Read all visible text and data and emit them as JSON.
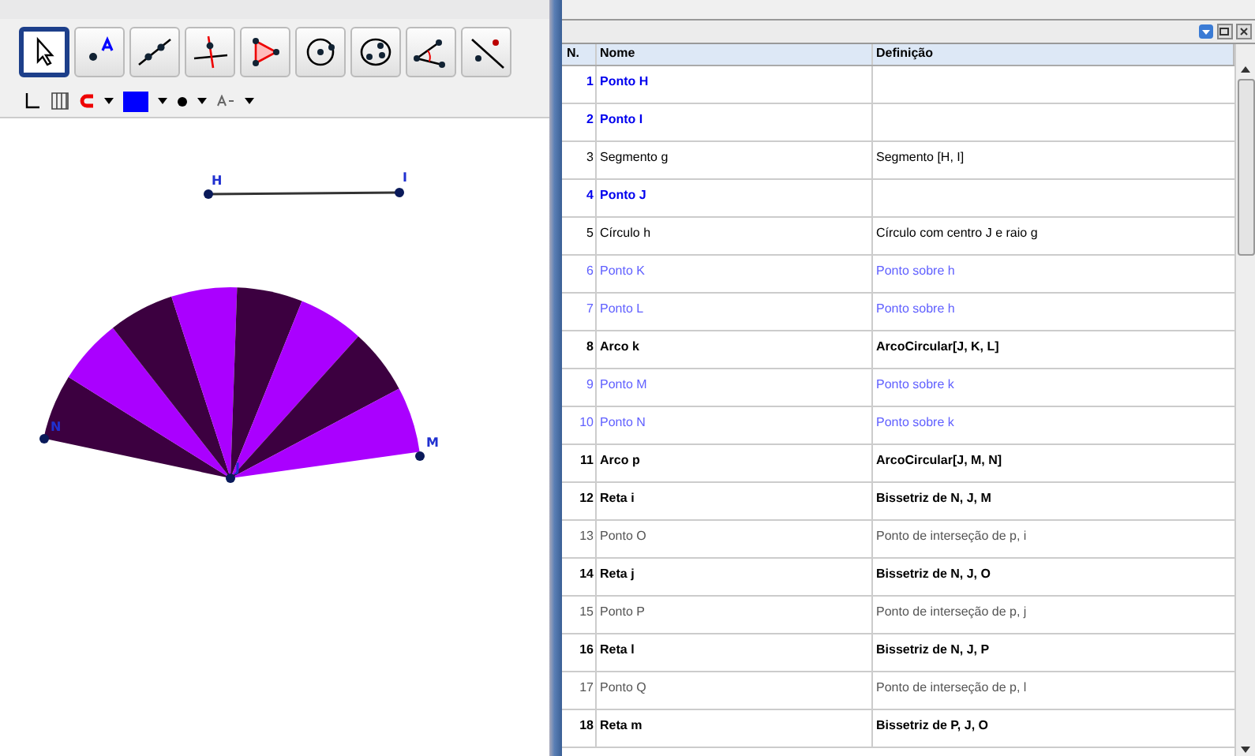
{
  "toolbar": {
    "tools": [
      {
        "kind": "move",
        "selected": true
      },
      {
        "kind": "point",
        "selected": false
      },
      {
        "kind": "line",
        "selected": false
      },
      {
        "kind": "perpendicular",
        "selected": false
      },
      {
        "kind": "polygon",
        "selected": false
      },
      {
        "kind": "circle",
        "selected": false
      },
      {
        "kind": "conic",
        "selected": false
      },
      {
        "kind": "angle",
        "selected": false
      },
      {
        "kind": "reflect",
        "selected": false
      }
    ]
  },
  "style_bar": {
    "color": "#0000ff"
  },
  "canvas": {
    "labels": {
      "H": "H",
      "I": "I",
      "N": "N",
      "M": "M",
      "J": "J"
    }
  },
  "algebra": {
    "columns": [
      "N.",
      "Nome",
      "Definição"
    ],
    "rows": [
      {
        "number": "1",
        "name": "Ponto H",
        "definition": "",
        "kind": "free"
      },
      {
        "number": "2",
        "name": "Ponto I",
        "definition": "",
        "kind": "free"
      },
      {
        "number": "3",
        "name": "Segmento g",
        "definition": "Segmento [H, I]",
        "kind": "plain"
      },
      {
        "number": "4",
        "name": "Ponto J",
        "definition": "",
        "kind": "free"
      },
      {
        "number": "5",
        "name": "Círculo h",
        "definition": "Círculo com centro J e raio g",
        "kind": "plain"
      },
      {
        "number": "6",
        "name": "Ponto K",
        "definition": "Ponto sobre h",
        "kind": "dependent"
      },
      {
        "number": "7",
        "name": "Ponto L",
        "definition": "Ponto sobre h",
        "kind": "dependent"
      },
      {
        "number": "8",
        "name": "Arco k",
        "definition": "ArcoCircular[J, K, L]",
        "kind": "bold"
      },
      {
        "number": "9",
        "name": "Ponto M",
        "definition": "Ponto sobre k",
        "kind": "dependent"
      },
      {
        "number": "10",
        "name": "Ponto N",
        "definition": "Ponto sobre k",
        "kind": "dependent"
      },
      {
        "number": "11",
        "name": "Arco p",
        "definition": "ArcoCircular[J, M, N]",
        "kind": "bold"
      },
      {
        "number": "12",
        "name": "Reta i",
        "definition": "Bissetriz de N, J, M",
        "kind": "bold"
      },
      {
        "number": "13",
        "name": "Ponto O",
        "definition": "Ponto de interseção de p, i",
        "kind": "auxiliary"
      },
      {
        "number": "14",
        "name": "Reta j",
        "definition": "Bissetriz de N, J, O",
        "kind": "bold"
      },
      {
        "number": "15",
        "name": "Ponto P",
        "definition": "Ponto de interseção de p, j",
        "kind": "auxiliary"
      },
      {
        "number": "16",
        "name": "Reta l",
        "definition": "Bissetriz de N, J, P",
        "kind": "bold"
      },
      {
        "number": "17",
        "name": "Ponto Q",
        "definition": "Ponto de interseção de p, l",
        "kind": "auxiliary"
      },
      {
        "number": "18",
        "name": "Reta m",
        "definition": "Bissetriz de P, J, O",
        "kind": "bold"
      }
    ]
  }
}
